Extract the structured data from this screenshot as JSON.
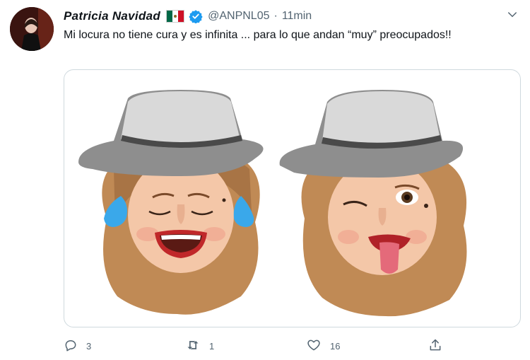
{
  "tweet": {
    "author_name": "Patricia Navidad",
    "handle": "@ANPNL05",
    "separator": "·",
    "time": "11min",
    "text": "Mi locura no tiene cura y es infinita ... para lo que andan “muy” preocupados!!",
    "flag_colors": [
      "#006847",
      "#ffffff",
      "#ce1126"
    ],
    "verified_color": "#1d9bf0"
  },
  "actions": {
    "reply_count": "3",
    "retweet_count": "1",
    "like_count": "16",
    "reply_icon": "reply-icon",
    "retweet_icon": "retweet-icon",
    "like_icon": "heart-icon",
    "share_icon": "share-icon"
  },
  "media": {
    "description_icons": [
      "laughing-tears-memoji",
      "winking-tongue-out-memoji"
    ]
  }
}
